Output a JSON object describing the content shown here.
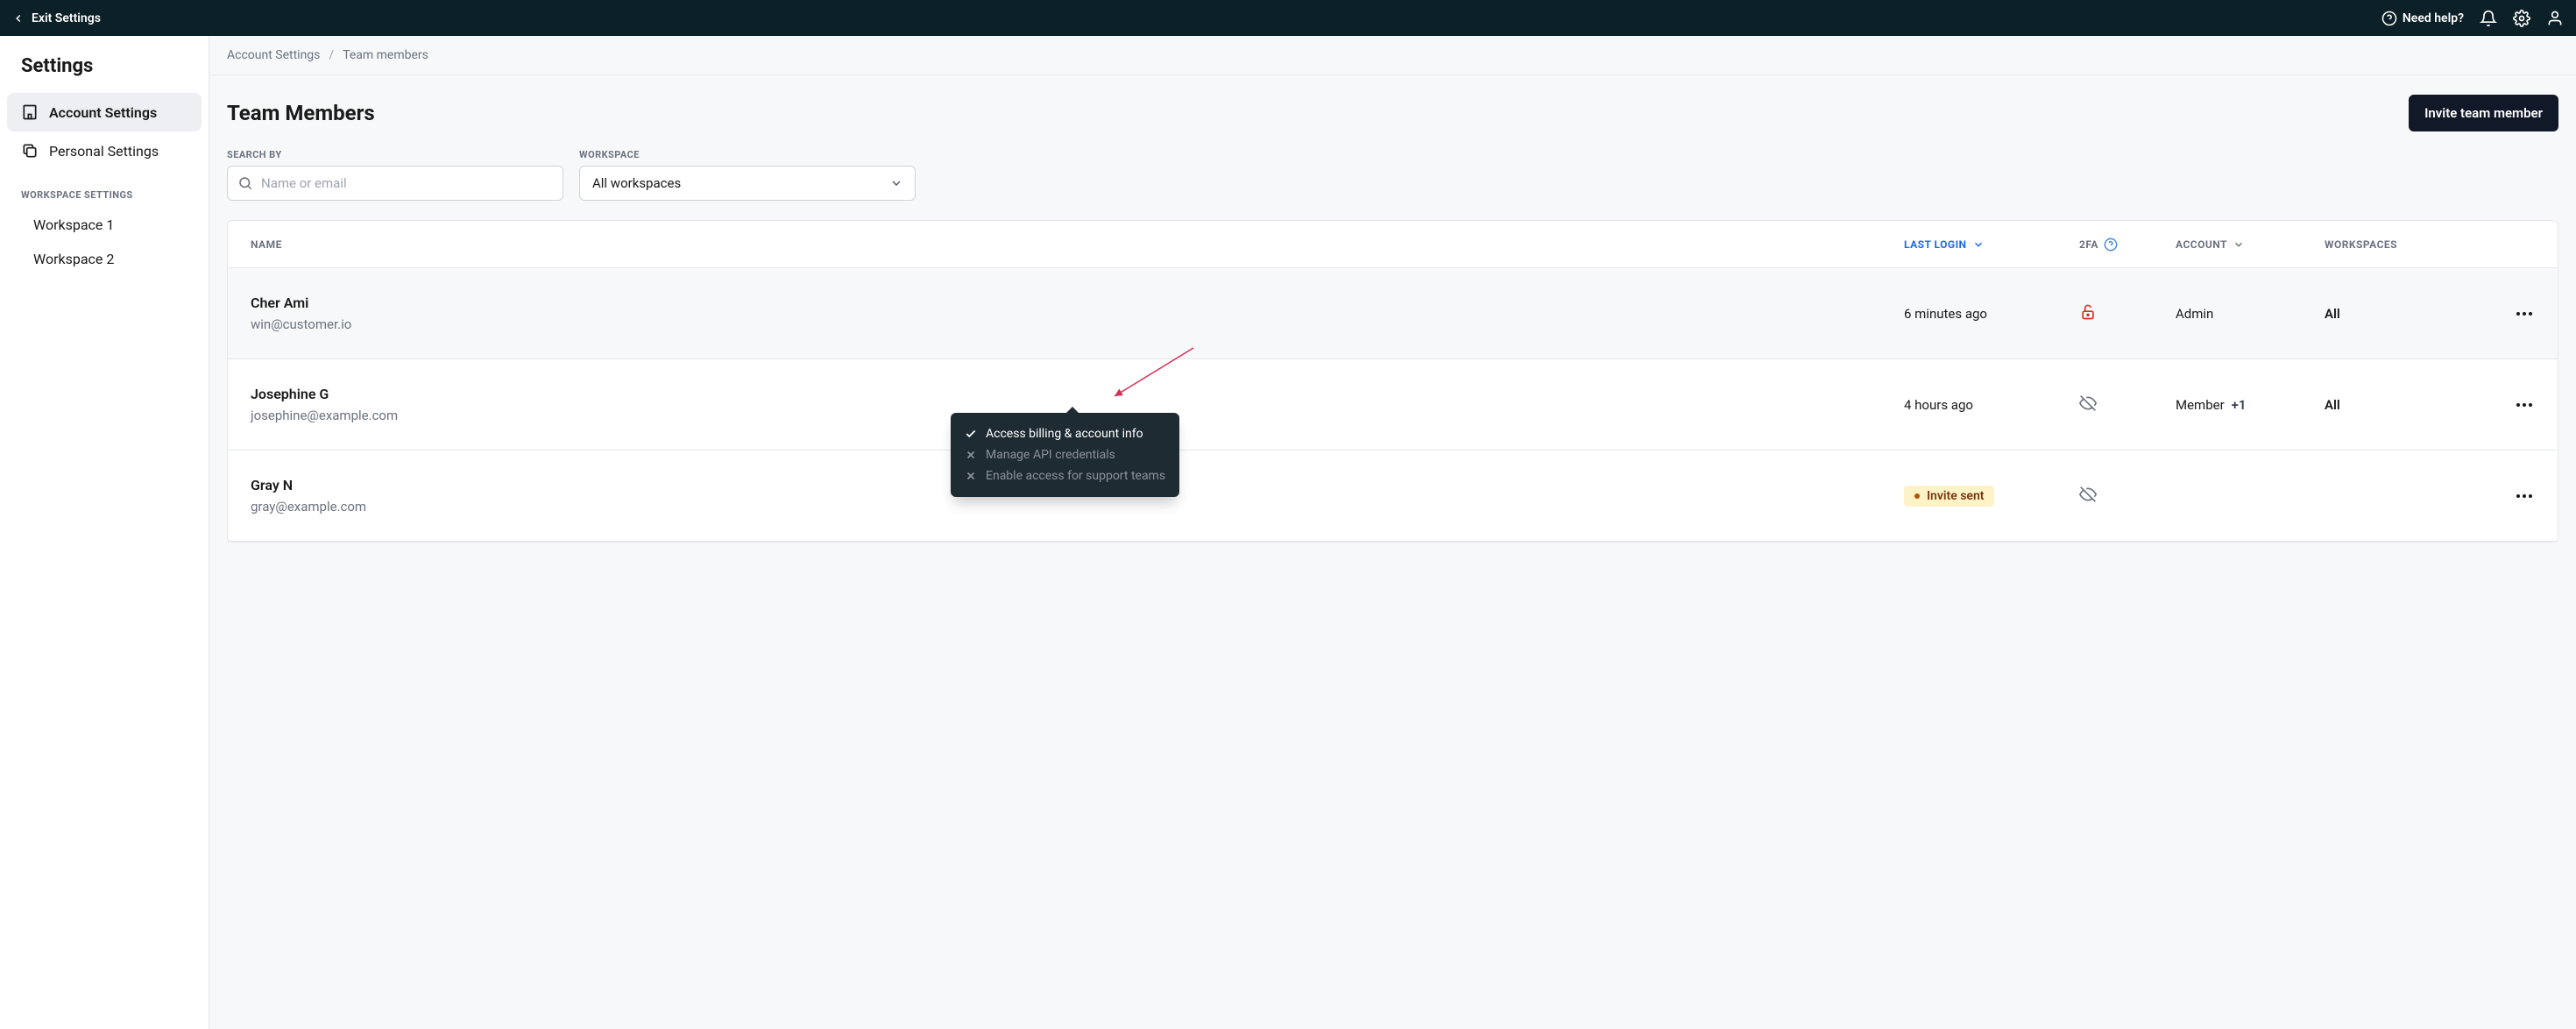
{
  "topbar": {
    "exit": "Exit Settings",
    "help": "Need help?"
  },
  "sidebar": {
    "title": "Settings",
    "account": "Account Settings",
    "personal": "Personal Settings",
    "ws_section": "WORKSPACE SETTINGS",
    "ws1": "Workspace 1",
    "ws2": "Workspace 2"
  },
  "crumbs": {
    "root": "Account Settings",
    "sep": "/",
    "leaf": "Team members"
  },
  "page": {
    "title": "Team Members",
    "invite": "Invite team member"
  },
  "filters": {
    "search_label": "SEARCH BY",
    "search_placeholder": "Name or email",
    "ws_label": "WORKSPACE",
    "ws_selected": "All workspaces"
  },
  "cols": {
    "name": "NAME",
    "login": "LAST LOGIN",
    "tfa": "2FA",
    "account": "ACCOUNT",
    "workspaces": "WORKSPACES"
  },
  "rows": [
    {
      "name": "Cher Ami",
      "email": "win@customer.io",
      "login": "6 minutes ago",
      "tfa": "unlocked",
      "acct": "Admin",
      "extra": "",
      "ws": "All"
    },
    {
      "name": "Josephine G",
      "email": "josephine@example.com",
      "login": "4 hours ago",
      "tfa": "hidden",
      "acct": "Member",
      "extra": "+1",
      "ws": "All"
    },
    {
      "name": "Gray N",
      "email": "gray@example.com",
      "login_pill": "Invite sent",
      "tfa": "hidden",
      "acct": "",
      "extra": "",
      "ws": ""
    }
  ],
  "tooltip": {
    "l1": "Access billing & account info",
    "l2": "Manage API credentials",
    "l3": "Enable access for support teams"
  }
}
